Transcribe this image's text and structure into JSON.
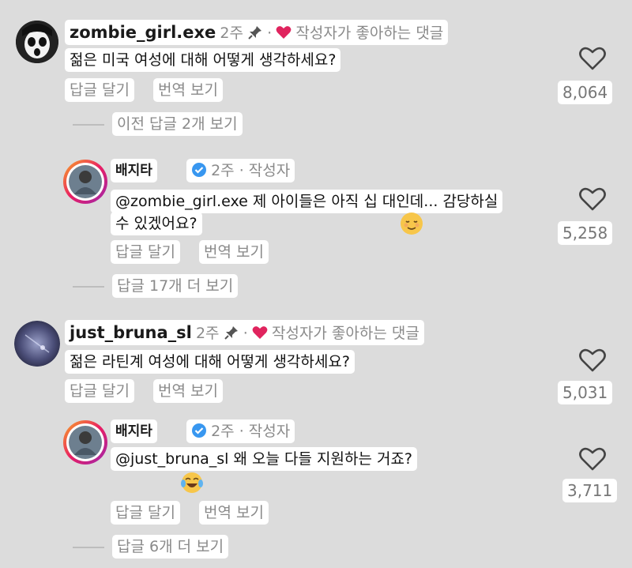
{
  "comments": [
    {
      "username": "zombie_girl.exe",
      "time": "2주",
      "separator": "·",
      "liked_label": "작성자가 좋아하는 댓글",
      "text": "젊은 미국 여성에 대해 어떻게 생각하세요?",
      "reply_label": "답글 달기",
      "translate_label": "번역 보기",
      "likes": "8,064",
      "view_replies": "이전 답글 2개 보기",
      "reply": {
        "username": "배지타",
        "time_meta": "2주 · 작성자",
        "text_line1": "@zombie_girl.exe 제 아이들은 아직 십 대인데... 감당하실",
        "text_line2": "수 있겠어요?",
        "reply_label": "답글 달기",
        "translate_label": "번역 보기",
        "likes": "5,258",
        "view_more": "답글 17개 더 보기"
      }
    },
    {
      "username": "just_bruna_sl",
      "time": "2주",
      "separator": "·",
      "liked_label": "작성자가 좋아하는 댓글",
      "text": "젊은 라틴계 여성에 대해 어떻게 생각하세요?",
      "reply_label": "답글 달기",
      "translate_label": "번역 보기",
      "likes": "5,031",
      "reply": {
        "username": "배지타",
        "time_meta": "2주 · 작성자",
        "text_line1": "@just_bruna_sl 왜 오늘 다들 지원하는 거죠?",
        "reply_label": "답글 달기",
        "translate_label": "번역 보기",
        "likes": "3,711",
        "view_more": "답글 6개 더 보기"
      }
    }
  ],
  "icons": {
    "heart": "heart-outline-icon",
    "pin": "pin-icon",
    "liked": "red-heart-icon",
    "verified": "verified-badge-icon"
  },
  "colors": {
    "background": "#dcdcdc",
    "chip": "#ffffff",
    "liked_heart": "#e0245e",
    "verified": "#3897f0",
    "muted_text": "#8a8a8a"
  }
}
